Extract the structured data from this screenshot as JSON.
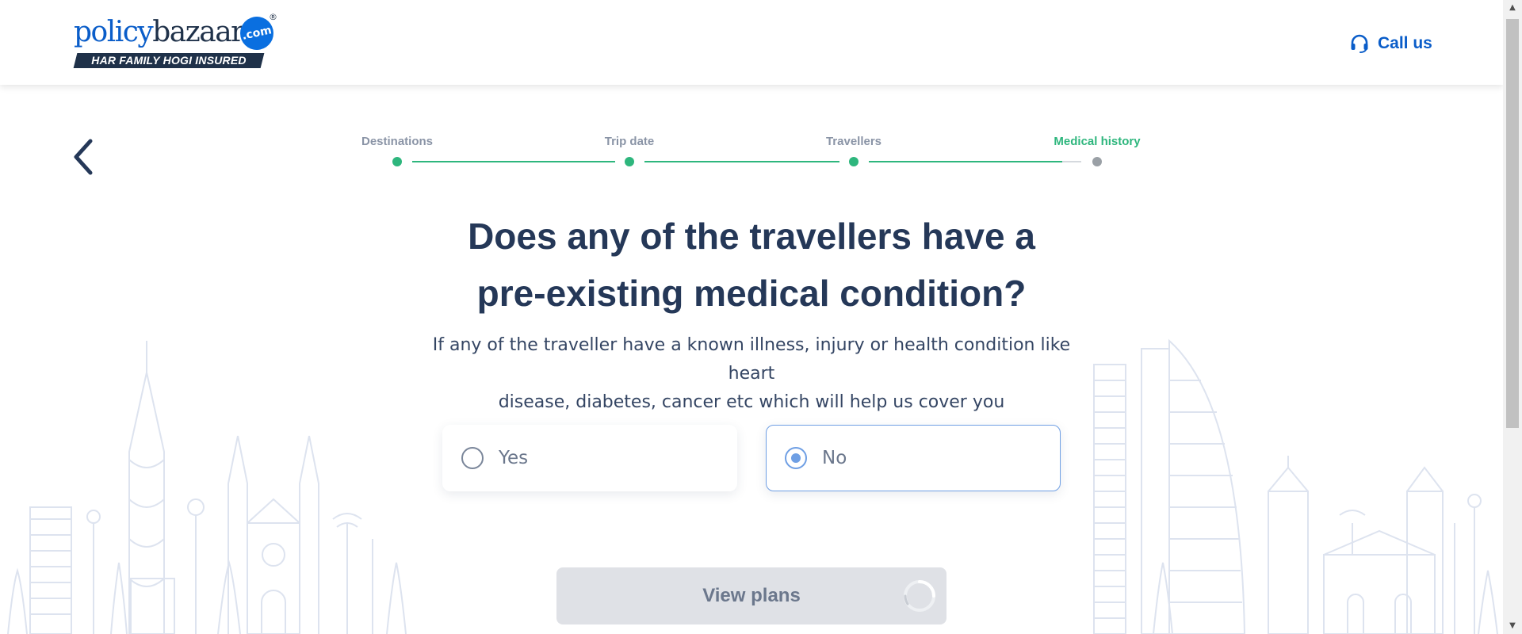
{
  "header": {
    "logo": {
      "word1": "policy",
      "word2": "bazaar",
      "badge": ".com",
      "registered": "®",
      "tagline": "HAR FAMILY HOGI INSURED"
    },
    "call_us": {
      "label": "Call us",
      "icon": "headset-icon"
    }
  },
  "navigation": {
    "back_icon": "chevron-left-icon"
  },
  "stepper": {
    "steps": [
      {
        "label": "Destinations",
        "state": "done"
      },
      {
        "label": "Trip date",
        "state": "done"
      },
      {
        "label": "Travellers",
        "state": "done"
      },
      {
        "label": "Medical history",
        "state": "active"
      }
    ]
  },
  "question": {
    "title_line1": "Does any of the travellers have a",
    "title_line2": "pre-existing medical condition?",
    "subtext_line1": "If any of the traveller have a known illness, injury or health condition like heart",
    "subtext_line2": "disease, diabetes, cancer etc which will help us cover you"
  },
  "options": [
    {
      "label": "Yes",
      "selected": false
    },
    {
      "label": "No",
      "selected": true
    }
  ],
  "actions": {
    "view_plans_label": "View plans",
    "loading": true
  },
  "colors": {
    "brand_blue": "#0a5dc9",
    "navy": "#253858",
    "step_green": "#2eb67d",
    "selected_border": "#6f9fe4",
    "button_disabled": "#dfe1e6"
  }
}
